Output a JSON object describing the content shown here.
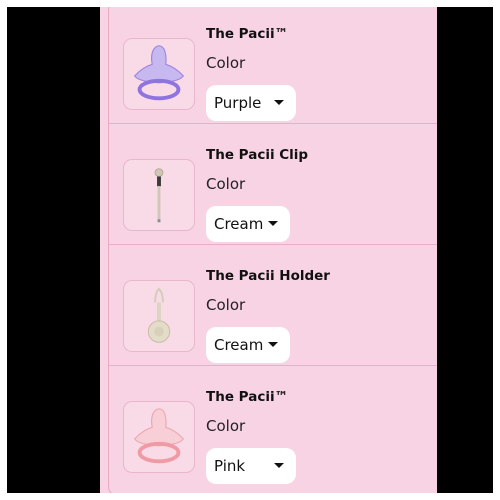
{
  "cart_items": [
    {
      "title": "The Pacii™",
      "option_label": "Color",
      "selected": "Purple",
      "image_icon": "purple-pacifier-icon",
      "tint": "#b9a3ec"
    },
    {
      "title": "The Pacii Clip",
      "option_label": "Color",
      "selected": "Cream",
      "image_icon": "pacifier-clip-icon",
      "tint": "#e8e2d2"
    },
    {
      "title": "The Pacii Holder",
      "option_label": "Color",
      "selected": "Cream",
      "image_icon": "pacifier-holder-icon",
      "tint": "#e6e1d0"
    },
    {
      "title": "The Pacii™",
      "option_label": "Color",
      "selected": "Pink",
      "image_icon": "pink-pacifier-icon",
      "tint": "#f5b7c4"
    }
  ]
}
